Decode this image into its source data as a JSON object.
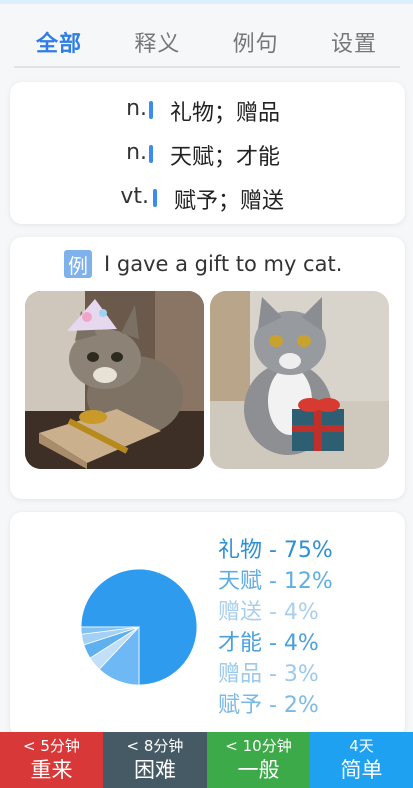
{
  "tabs": [
    {
      "label": "全部",
      "active": true
    },
    {
      "label": "释义",
      "active": false
    },
    {
      "label": "例句",
      "active": false
    },
    {
      "label": "设置",
      "active": false
    }
  ],
  "definitions": [
    {
      "pos": "n.",
      "meaning": "礼物；赠品"
    },
    {
      "pos": "n.",
      "meaning": "天赋；才能"
    },
    {
      "pos": "vt.",
      "meaning": "赋予；赠送"
    }
  ],
  "example": {
    "badge": "例",
    "sentence": "I gave a gift to my cat.",
    "images": [
      "cat-with-gift-box-and-party-hat",
      "grey-cat-with-red-ribbon-gift"
    ]
  },
  "chart_data": {
    "type": "pie",
    "labels": [
      "礼物",
      "天赋",
      "赠送",
      "才能",
      "赠品",
      "赋予"
    ],
    "values": [
      75,
      12,
      4,
      4,
      3,
      2
    ],
    "legend": [
      "礼物 - 75%",
      "天赋 - 12%",
      "赠送 - 4%",
      "才能 - 4%",
      "赠品 - 3%",
      "赋予 - 2%"
    ],
    "colors": [
      "#2f9bef",
      "#6db8f5",
      "#c2dff8",
      "#5fb0ef",
      "#a3d0f6",
      "#84c1f3"
    ],
    "legend_colors": [
      "#2d8fd8",
      "#5eaee6",
      "#a8cfee",
      "#4aa1de",
      "#9cc9ec",
      "#7bb9e6"
    ],
    "legend_placement": "right"
  },
  "buttons": [
    {
      "time": "< 5分钟",
      "label": "重来",
      "color": "#d93838"
    },
    {
      "time": "< 8分钟",
      "label": "困难",
      "color": "#455a64"
    },
    {
      "time": "< 10分钟",
      "label": "一般",
      "color": "#3daa49"
    },
    {
      "time": "4天",
      "label": "简单",
      "color": "#1da1f0"
    }
  ]
}
